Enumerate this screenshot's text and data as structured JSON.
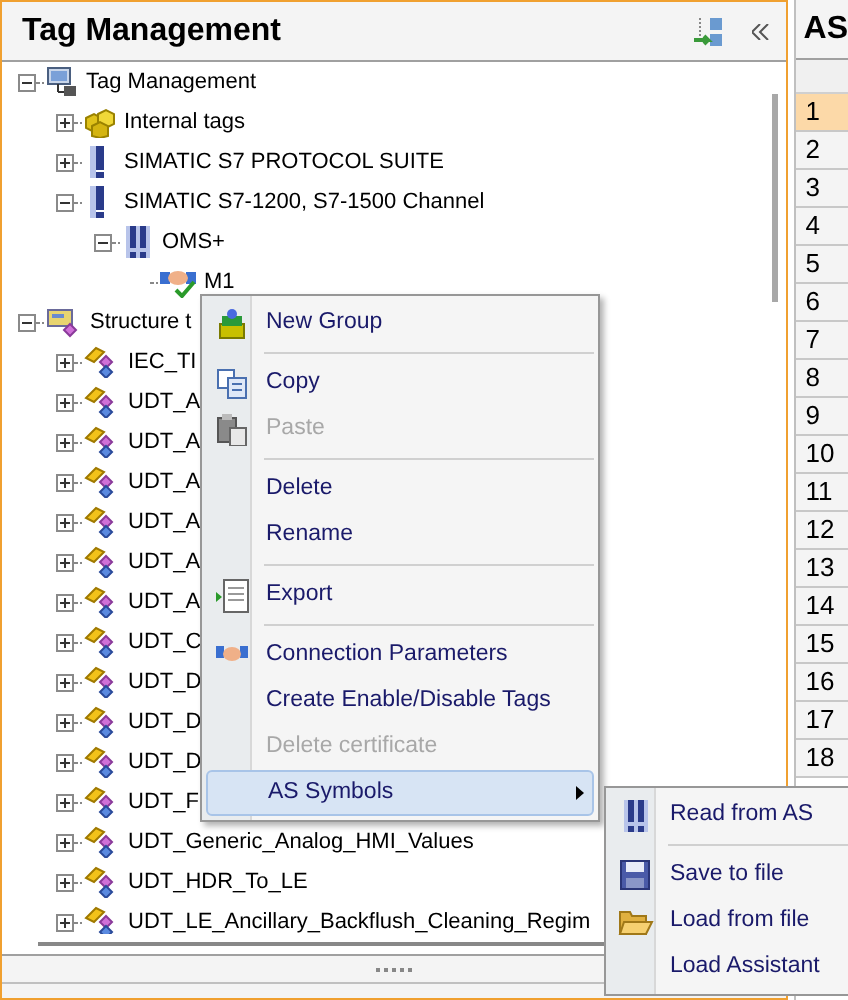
{
  "panel": {
    "title": "Tag Management"
  },
  "tree": [
    {
      "label": "Tag Management",
      "kind": "root",
      "expanded": true,
      "children": [
        {
          "label": "Internal tags",
          "kind": "internal",
          "expanded": false
        },
        {
          "label": "SIMATIC S7 PROTOCOL SUITE",
          "kind": "channel",
          "expanded": false
        },
        {
          "label": "SIMATIC S7-1200, S7-1500 Channel",
          "kind": "channel",
          "expanded": true,
          "children": [
            {
              "label": "OMS+",
              "kind": "connection",
              "expanded": true,
              "children": [
                {
                  "label": "M1",
                  "kind": "device"
                }
              ]
            }
          ]
        }
      ]
    },
    {
      "label": "Structure t",
      "kind": "structures",
      "expanded": true,
      "children": [
        {
          "label": "IEC_TI",
          "kind": "structure",
          "expanded": false
        },
        {
          "label": "UDT_A",
          "kind": "structure",
          "expanded": false
        },
        {
          "label": "UDT_A",
          "kind": "structure",
          "expanded": false
        },
        {
          "label": "UDT_A",
          "kind": "structure",
          "expanded": false
        },
        {
          "label": "UDT_A",
          "kind": "structure",
          "expanded": false
        },
        {
          "label": "UDT_A",
          "kind": "structure",
          "expanded": false
        },
        {
          "label": "UDT_A",
          "kind": "structure",
          "expanded": false
        },
        {
          "label": "UDT_C",
          "kind": "structure",
          "expanded": false
        },
        {
          "label": "UDT_D",
          "kind": "structure",
          "expanded": false
        },
        {
          "label": "UDT_D",
          "kind": "structure",
          "expanded": false
        },
        {
          "label": "UDT_D",
          "kind": "structure",
          "expanded": false
        },
        {
          "label": "UDT_F",
          "kind": "structure",
          "expanded": false
        },
        {
          "label": "UDT_Generic_Analog_HMI_Values",
          "kind": "structure",
          "expanded": false
        },
        {
          "label": "UDT_HDR_To_LE",
          "kind": "structure",
          "expanded": false
        },
        {
          "label": "UDT_LE_Ancillary_Backflush_Cleaning_Regim",
          "kind": "structure",
          "expanded": false
        }
      ]
    }
  ],
  "context_menu": [
    {
      "kind": "item",
      "label": "New Group",
      "disabled": false
    },
    {
      "kind": "separator"
    },
    {
      "kind": "item",
      "label": "Copy",
      "disabled": false
    },
    {
      "kind": "item",
      "label": "Paste",
      "disabled": true
    },
    {
      "kind": "separator"
    },
    {
      "kind": "item",
      "label": "Delete",
      "disabled": false
    },
    {
      "kind": "item",
      "label": "Rename",
      "disabled": false
    },
    {
      "kind": "separator"
    },
    {
      "kind": "item",
      "label": "Export",
      "disabled": false
    },
    {
      "kind": "separator"
    },
    {
      "kind": "item",
      "label": "Connection Parameters",
      "disabled": false
    },
    {
      "kind": "item",
      "label": "Create Enable/Disable Tags",
      "disabled": false
    },
    {
      "kind": "item",
      "label": "Delete certificate",
      "disabled": true
    },
    {
      "kind": "submenu",
      "label": "AS Symbols",
      "disabled": false
    }
  ],
  "submenu": [
    {
      "kind": "item",
      "label": "Read from AS"
    },
    {
      "kind": "separator"
    },
    {
      "kind": "item",
      "label": "Save to file"
    },
    {
      "kind": "item",
      "label": "Load from file"
    },
    {
      "kind": "item",
      "label": "Load Assistant"
    }
  ],
  "side_table": {
    "title": "AS",
    "rows": [
      {
        "label": "1",
        "selected": true
      },
      {
        "label": "2",
        "selected": false
      },
      {
        "label": "3",
        "selected": false
      },
      {
        "label": "4",
        "selected": false
      },
      {
        "label": "5",
        "selected": false
      },
      {
        "label": "6",
        "selected": false
      },
      {
        "label": "7",
        "selected": false
      },
      {
        "label": "8",
        "selected": false
      },
      {
        "label": "9",
        "selected": false
      },
      {
        "label": "10",
        "selected": false
      },
      {
        "label": "11",
        "selected": false
      },
      {
        "label": "12",
        "selected": false
      },
      {
        "label": "13",
        "selected": false
      },
      {
        "label": "14",
        "selected": false
      },
      {
        "label": "15",
        "selected": false
      },
      {
        "label": "16",
        "selected": false
      },
      {
        "label": "17",
        "selected": false
      },
      {
        "label": "18",
        "selected": false
      }
    ]
  }
}
